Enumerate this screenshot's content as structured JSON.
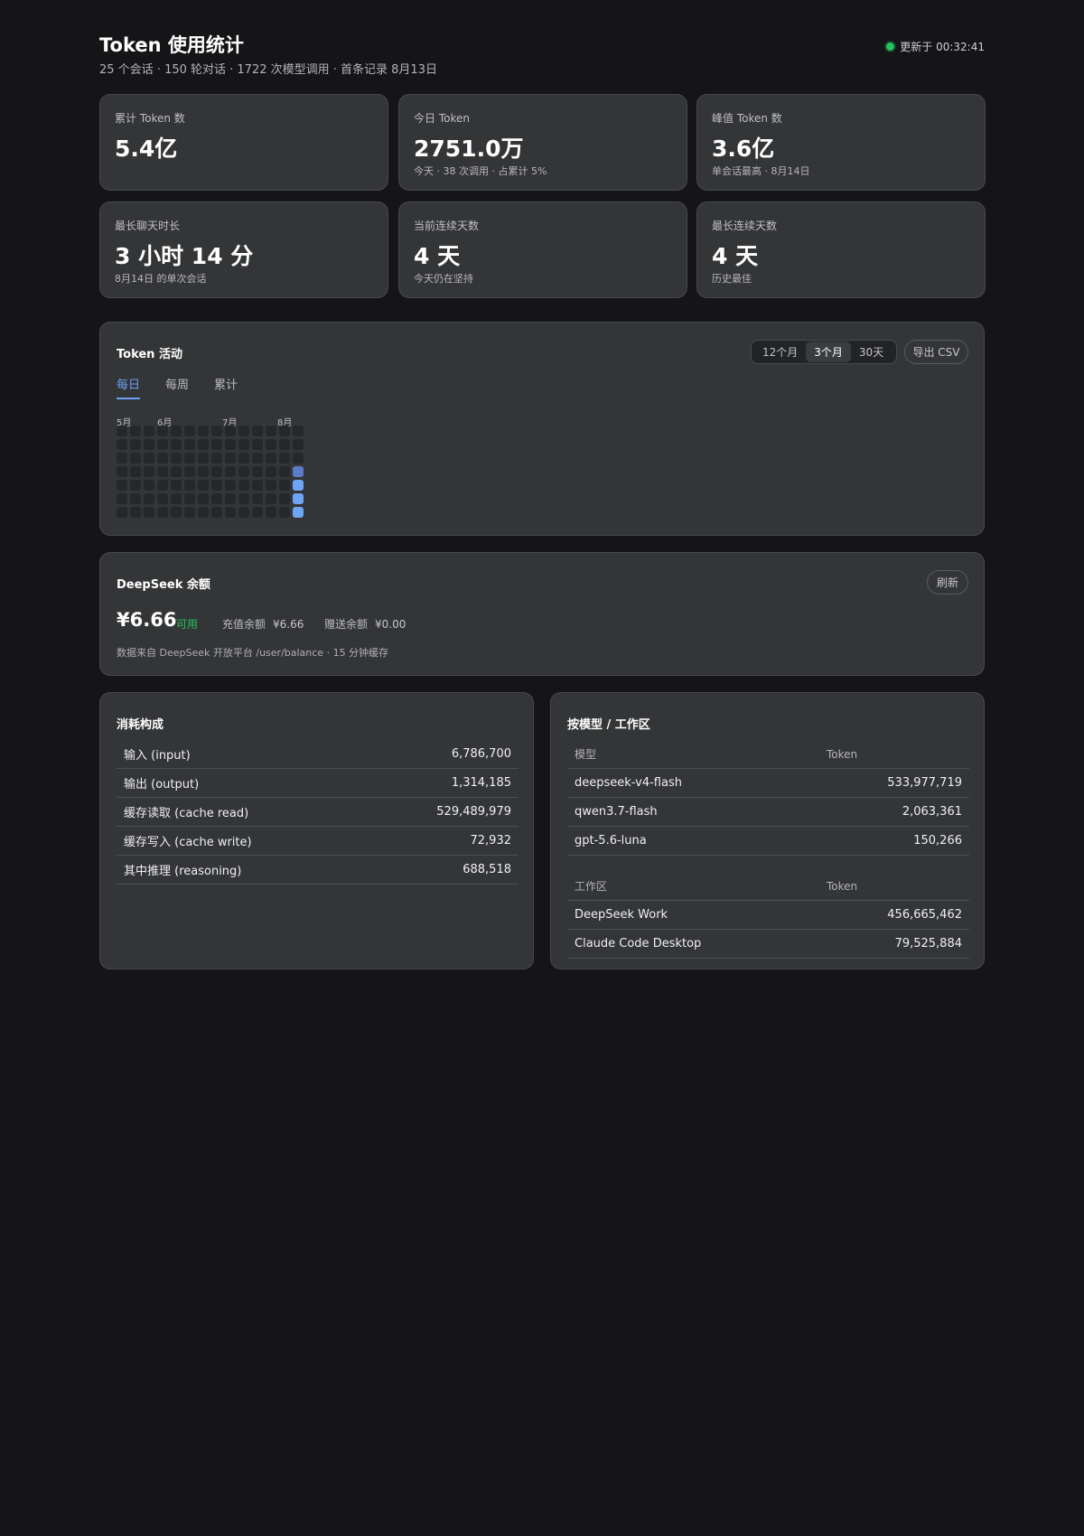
{
  "header": {
    "title": "Token 使用统计",
    "subtitle": "25 个会话 · 150 轮对话 · 1722 次模型调用 · 首条记录 8月13日",
    "updated": "更新于 00:32:41"
  },
  "stats": [
    {
      "label": "累计 Token 数",
      "value": "5.4亿",
      "sub": ""
    },
    {
      "label": "今日 Token",
      "value": "2751.0万",
      "sub": "今天 · 38 次调用 · 占累计 5%"
    },
    {
      "label": "峰值 Token 数",
      "value": "3.6亿",
      "sub": "单会话最高 · 8月14日"
    },
    {
      "label": "最长聊天时长",
      "value": "3 小时 14 分",
      "sub": "8月14日 的单次会话"
    },
    {
      "label": "当前连续天数",
      "value": "4 天",
      "sub": "今天仍在坚持"
    },
    {
      "label": "最长连续天数",
      "value": "4 天",
      "sub": "历史最佳"
    }
  ],
  "activity": {
    "title": "Token 活动",
    "ranges": [
      "12个月",
      "3个月",
      "30天"
    ],
    "active_range": "3个月",
    "export_label": "导出 CSV",
    "tabs": [
      "每日",
      "每周",
      "累计"
    ],
    "active_tab": "每日",
    "months": [
      "5月",
      "6月",
      "7月",
      "8月"
    ],
    "heatmap": {
      "weeks": 14,
      "days": 7,
      "active": [
        {
          "week": 13,
          "day": 3,
          "level": 2
        },
        {
          "week": 13,
          "day": 4,
          "level": 3
        },
        {
          "week": 13,
          "day": 5,
          "level": 3
        },
        {
          "week": 13,
          "day": 6,
          "level": 3
        }
      ],
      "colors": {
        "empty": "#26272a",
        "l2": "#5b7dc9",
        "l3": "#6ea6f7"
      }
    }
  },
  "balance": {
    "title": "DeepSeek 余额",
    "refresh_label": "刷新",
    "amount": "¥6.66",
    "available": "可用",
    "topup_label": "充值余额",
    "topup_value": "¥6.66",
    "gift_label": "赠送余额",
    "gift_value": "¥0.00",
    "note": "数据来自 DeepSeek 开放平台 /user/balance · 15 分钟缓存"
  },
  "consumption": {
    "title": "消耗构成",
    "rows": [
      {
        "label": "输入 (input)",
        "value": "6,786,700"
      },
      {
        "label": "输出 (output)",
        "value": "1,314,185"
      },
      {
        "label": "缓存读取 (cache read)",
        "value": "529,489,979"
      },
      {
        "label": "缓存写入 (cache write)",
        "value": "72,932"
      },
      {
        "label": "其中推理 (reasoning)",
        "value": "688,518"
      }
    ]
  },
  "breakdown": {
    "title": "按模型 / 工作区",
    "model_head": "模型",
    "token_head": "Token",
    "models": [
      {
        "name": "deepseek-v4-flash",
        "value": "533,977,719"
      },
      {
        "name": "qwen3.7-flash",
        "value": "2,063,361"
      },
      {
        "name": "gpt-5.6-luna",
        "value": "150,266"
      }
    ],
    "workspace_head": "工作区",
    "workspaces": [
      {
        "name": "DeepSeek Work",
        "value": "456,665,462"
      },
      {
        "name": "Claude Code Desktop",
        "value": "79,525,884"
      }
    ]
  }
}
